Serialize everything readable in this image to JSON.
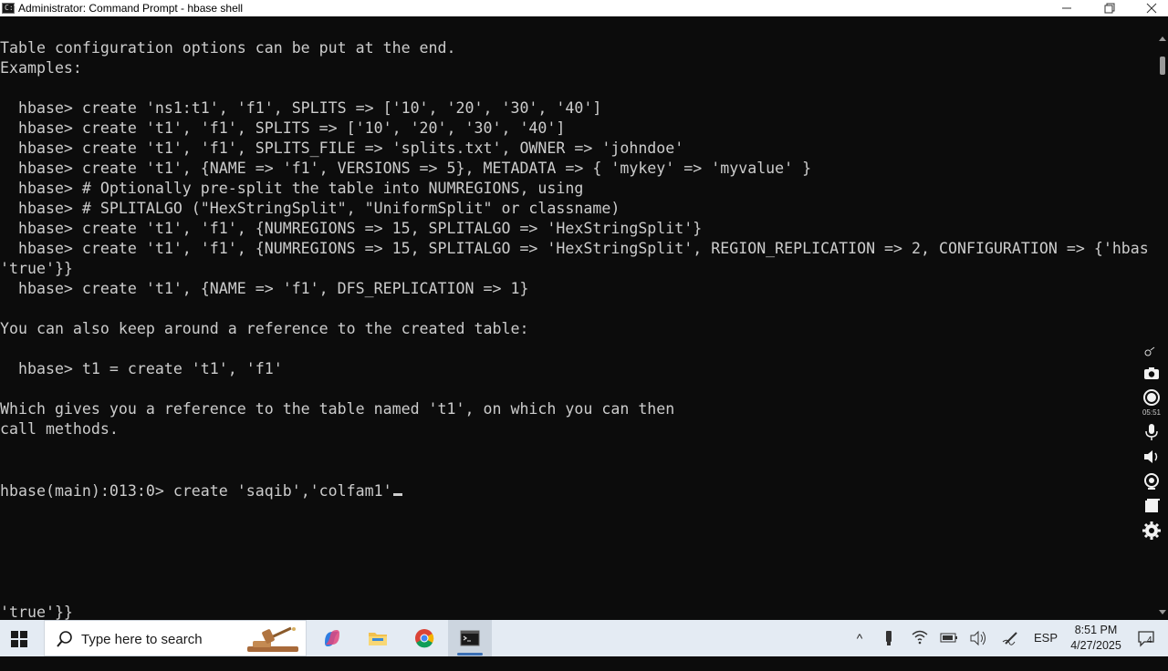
{
  "window": {
    "title": "Administrator: Command Prompt - hbase  shell",
    "app_icon_text": "C:\\",
    "minimize_icon": "minimize-icon",
    "maximize_icon": "restore-icon",
    "close_icon": "close-icon"
  },
  "console": {
    "text_color": "#cccccc",
    "background": "#0c0c0c",
    "lines": [
      "Table configuration options can be put at the end.",
      "Examples:",
      "",
      "  hbase> create 'ns1:t1', 'f1', SPLITS => ['10', '20', '30', '40']",
      "  hbase> create 't1', 'f1', SPLITS => ['10', '20', '30', '40']",
      "  hbase> create 't1', 'f1', SPLITS_FILE => 'splits.txt', OWNER => 'johndoe'",
      "  hbase> create 't1', {NAME => 'f1', VERSIONS => 5}, METADATA => { 'mykey' => 'myvalue' }",
      "  hbase> # Optionally pre-split the table into NUMREGIONS, using",
      "  hbase> # SPLITALGO (\"HexStringSplit\", \"UniformSplit\" or classname)",
      "  hbase> create 't1', 'f1', {NUMREGIONS => 15, SPLITALGO => 'HexStringSplit'}",
      "  hbase> create 't1', 'f1', {NUMREGIONS => 15, SPLITALGO => 'HexStringSplit', REGION_REPLICATION => 2, CONFIGURATION => {'hbas",
      "'true'}}",
      "  hbase> create 't1', {NAME => 'f1', DFS_REPLICATION => 1}",
      "",
      "You can also keep around a reference to the created table:",
      "",
      "  hbase> t1 = create 't1', 'f1'",
      "",
      "Which gives you a reference to the table named 't1', on which you can then",
      "call methods."
    ],
    "prompt": "hbase(main):013:0> ",
    "input": "create 'saqib','colfam1'",
    "bottom_line": "'true'}}"
  },
  "sidebar_tools": {
    "icons": [
      "pin-icon",
      "camera-icon",
      "record-icon",
      "microphone-icon",
      "speaker-icon",
      "webcam-icon",
      "window-icon",
      "gear-icon"
    ],
    "timer": "05:51"
  },
  "taskbar": {
    "search_placeholder": "Type here to search",
    "apps": [
      "copilot-icon",
      "file-explorer-icon",
      "chrome-icon",
      "command-prompt-icon"
    ],
    "tray": {
      "chevron": "^",
      "language": "ESP",
      "time": "8:51 PM",
      "date": "4/27/2025",
      "notification_count": "4"
    }
  }
}
